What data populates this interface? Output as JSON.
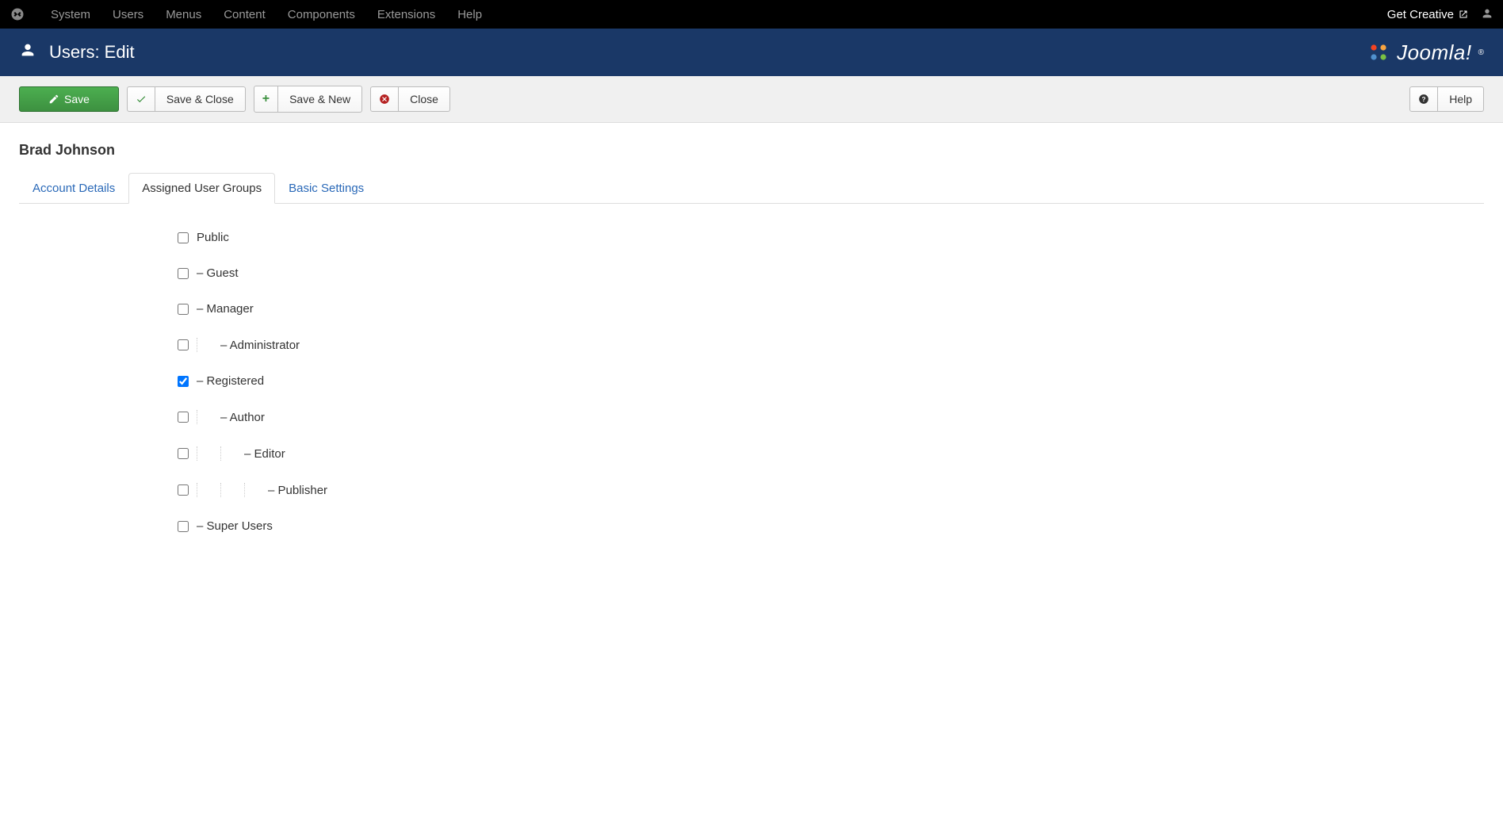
{
  "topbar": {
    "menu": [
      "System",
      "Users",
      "Menus",
      "Content",
      "Components",
      "Extensions",
      "Help"
    ],
    "site_name": "Get Creative"
  },
  "header": {
    "title": "Users: Edit",
    "brand": "Joomla!"
  },
  "toolbar": {
    "save": "Save",
    "save_close": "Save & Close",
    "save_new": "Save & New",
    "close": "Close",
    "help": "Help"
  },
  "page": {
    "user_name": "Brad Johnson"
  },
  "tabs": [
    {
      "label": "Account Details",
      "active": false
    },
    {
      "label": "Assigned User Groups",
      "active": true
    },
    {
      "label": "Basic Settings",
      "active": false
    }
  ],
  "groups": [
    {
      "label": "Public",
      "depth": 0,
      "checked": false
    },
    {
      "label": "– Guest",
      "depth": 0,
      "checked": false
    },
    {
      "label": "– Manager",
      "depth": 0,
      "checked": false
    },
    {
      "label": "– Administrator",
      "depth": 1,
      "checked": false
    },
    {
      "label": "– Registered",
      "depth": 0,
      "checked": true
    },
    {
      "label": "– Author",
      "depth": 1,
      "checked": false
    },
    {
      "label": "– Editor",
      "depth": 2,
      "checked": false
    },
    {
      "label": "– Publisher",
      "depth": 3,
      "checked": false
    },
    {
      "label": "– Super Users",
      "depth": 0,
      "checked": false
    }
  ]
}
